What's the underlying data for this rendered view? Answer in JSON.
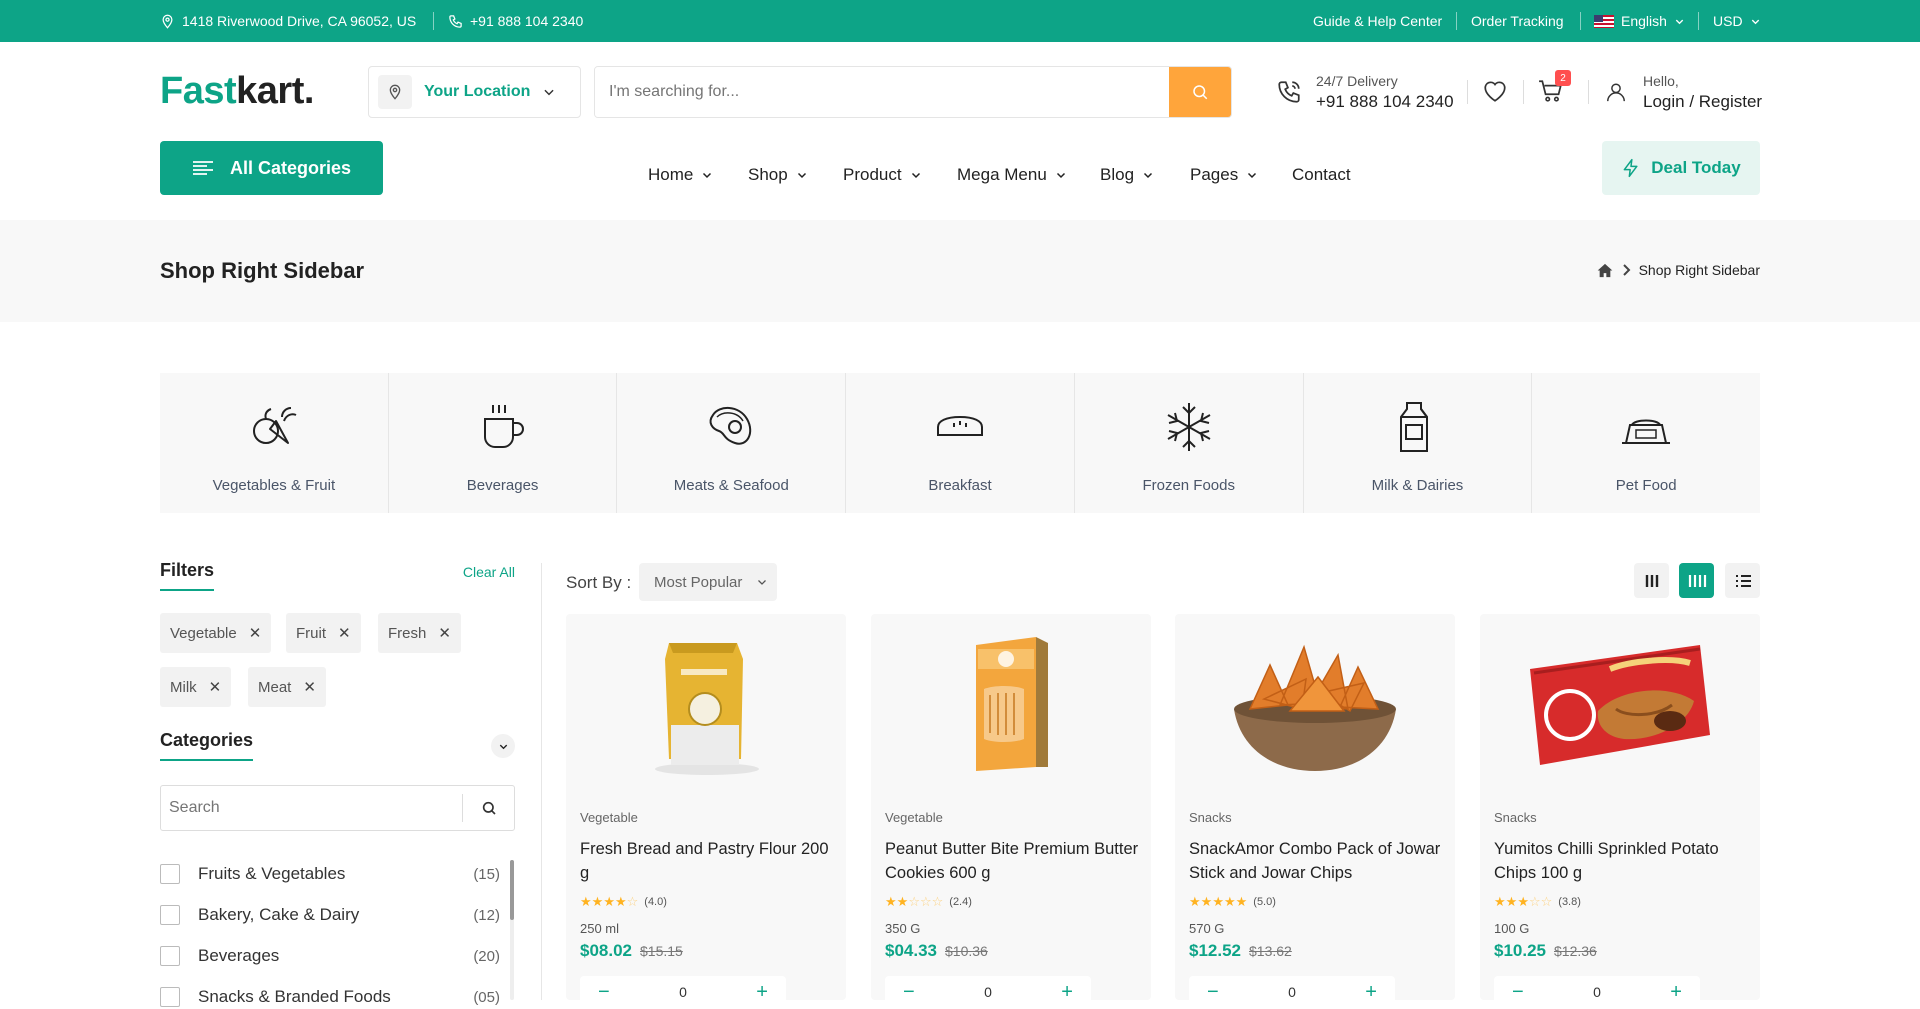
{
  "topbar": {
    "address": "1418 Riverwood Drive, CA 96052, US",
    "phone": "+91 888 104 2340",
    "guide": "Guide & Help Center",
    "tracking": "Order Tracking",
    "language": "English",
    "currency": "USD"
  },
  "brand": {
    "part1": "Fast",
    "part2": "kart."
  },
  "location": {
    "label": "Your Location"
  },
  "search": {
    "placeholder": "I'm searching for..."
  },
  "delivery": {
    "label": "24/7 Delivery",
    "phone": "+91 888 104 2340"
  },
  "cart": {
    "count": "2"
  },
  "account": {
    "hello": "Hello,",
    "action": "Login / Register"
  },
  "nav": {
    "all_categories": "All Categories",
    "items": [
      "Home",
      "Shop",
      "Product",
      "Mega Menu",
      "Blog",
      "Pages",
      "Contact"
    ],
    "deal": "Deal Today"
  },
  "page": {
    "title": "Shop Right Sidebar",
    "crumb": "Shop Right Sidebar"
  },
  "categories_bar": [
    {
      "label": "Vegetables & Fruit",
      "icon": "vegetables-icon"
    },
    {
      "label": "Beverages",
      "icon": "cup-icon"
    },
    {
      "label": "Meats & Seafood",
      "icon": "steak-icon"
    },
    {
      "label": "Breakfast",
      "icon": "bread-icon"
    },
    {
      "label": "Frozen Foods",
      "icon": "snowflake-icon"
    },
    {
      "label": "Milk & Dairies",
      "icon": "milk-icon"
    },
    {
      "label": "Pet Food",
      "icon": "pet-bowl-icon"
    }
  ],
  "filters": {
    "title": "Filters",
    "clear": "Clear All",
    "chips": [
      "Vegetable",
      "Fruit",
      "Fresh",
      "Milk",
      "Meat"
    ],
    "categories_title": "Categories",
    "search_placeholder": "Search",
    "list": [
      {
        "label": "Fruits & Vegetables",
        "count": "(15)"
      },
      {
        "label": "Bakery, Cake & Dairy",
        "count": "(12)"
      },
      {
        "label": "Beverages",
        "count": "(20)"
      },
      {
        "label": "Snacks & Branded Foods",
        "count": "(05)"
      }
    ]
  },
  "toolbar": {
    "sort_label": "Sort By :",
    "sort_value": "Most Popular"
  },
  "products": [
    {
      "category": "Vegetable",
      "name": "Fresh Bread and Pastry Flour 200 g",
      "rating": 4,
      "rating_text": "(4.0)",
      "unit": "250 ml",
      "price": "$08.02",
      "old_price": "$15.15",
      "qty": "0"
    },
    {
      "category": "Vegetable",
      "name": "Peanut Butter Bite Premium Butter Cookies 600 g",
      "rating": 2,
      "rating_text": "(2.4)",
      "unit": "350 G",
      "price": "$04.33",
      "old_price": "$10.36",
      "qty": "0"
    },
    {
      "category": "Snacks",
      "name": "SnackAmor Combo Pack of Jowar Stick and Jowar Chips",
      "rating": 5,
      "rating_text": "(5.0)",
      "unit": "570 G",
      "price": "$12.52",
      "old_price": "$13.62",
      "qty": "0"
    },
    {
      "category": "Snacks",
      "name": "Yumitos Chilli Sprinkled Potato Chips 100 g",
      "rating": 3,
      "rating_text": "(3.8)",
      "unit": "100 G",
      "price": "$10.25",
      "old_price": "$12.36",
      "qty": "0"
    }
  ],
  "colors": {
    "primary": "#0da487",
    "accent": "#ffa53b",
    "star": "#ffb321"
  }
}
